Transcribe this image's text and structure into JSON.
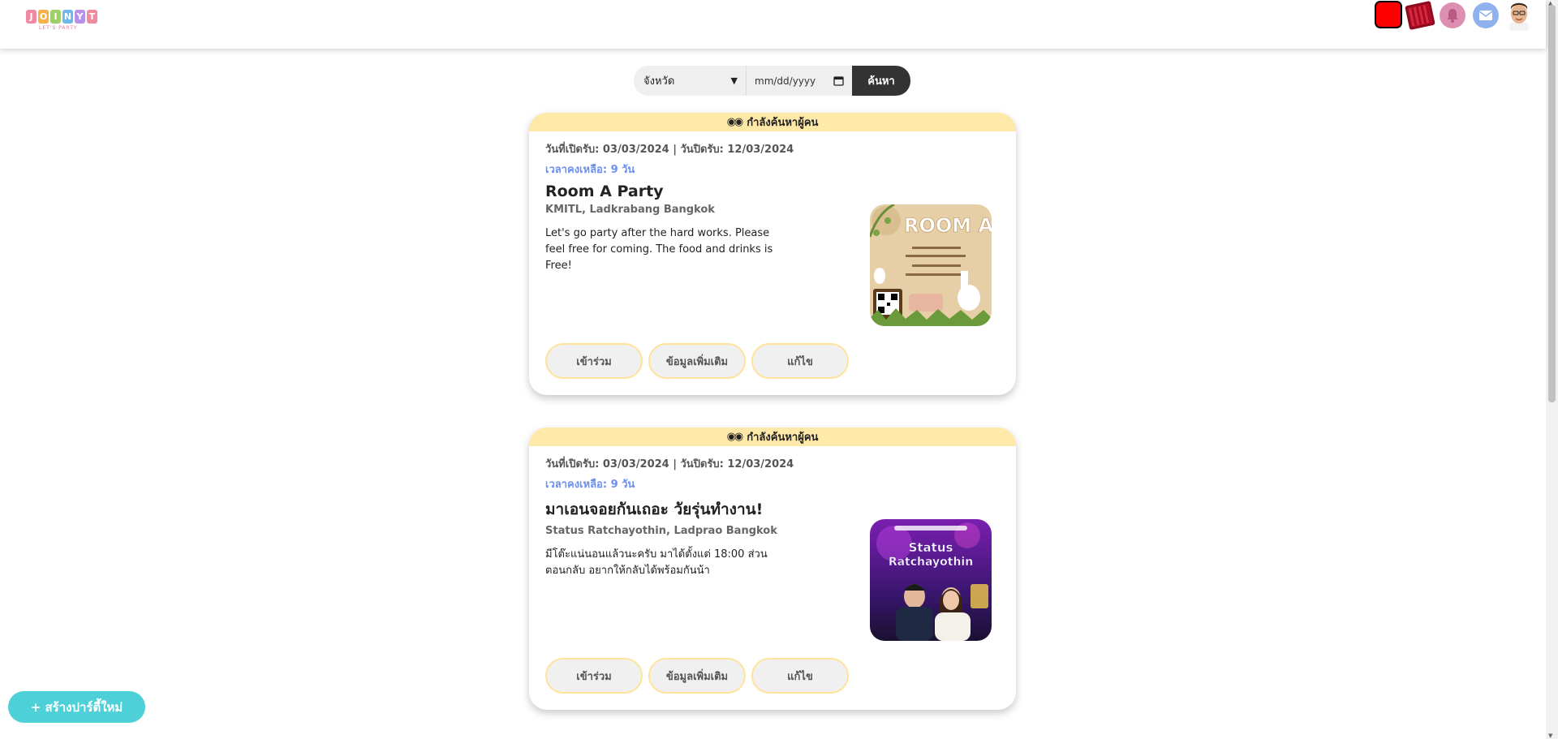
{
  "header": {
    "logo_text": "JOINYT",
    "logo_sub": "LET'S PARTY",
    "icons": [
      "red-square-icon",
      "ticket-icon",
      "bell-icon",
      "mail-icon",
      "avatar"
    ]
  },
  "search": {
    "province_label": "จังหวัด",
    "date_placeholder": "mm/dd/yyyy",
    "button_label": "ค้นหา"
  },
  "cards": [
    {
      "status": "กำลังค้นหาผู้คน",
      "dates": "วันที่เปิดรับ: 03/03/2024 | วันปิดรับ: 12/03/2024",
      "remain": "เวลาคงเหลือ: 9 วัน",
      "title": "Room A Party",
      "location": "KMITL, Ladkrabang Bangkok",
      "description": "Let's go party after the hard works. Please feel free for coming. The food and drinks is Free!",
      "image_label": "ROOM A",
      "buttons": {
        "join": "เข้าร่วม",
        "more": "ข้อมูลเพิ่มเติม",
        "edit": "แก้ไข"
      }
    },
    {
      "status": "กำลังค้นหาผู้คน",
      "dates": "วันที่เปิดรับ: 03/03/2024 | วันปิดรับ: 12/03/2024",
      "remain": "เวลาคงเหลือ: 9 วัน",
      "title": "มาเอนจอยกันเถอะ วัยรุ่นทำงาน!",
      "location": "Status Ratchayothin, Ladprao Bangkok",
      "description": "มีโต๊ะแน่นอนแล้วนะครับ มาได้ตั้งแต่ 18:00 ส่วนตอนกลับ อยากให้กลับได้พร้อมกันน้า",
      "image_label": "Status Ratchayothin",
      "buttons": {
        "join": "เข้าร่วม",
        "more": "ข้อมูลเพิ่มเติม",
        "edit": "แก้ไข"
      }
    }
  ],
  "fab": {
    "label": "+ สร้างปาร์ตี้ใหม่"
  },
  "colors": {
    "status_bg": "#ffe9a8",
    "remain_text": "#6c8ff0",
    "fab_bg": "#4dd0d8",
    "search_btn_bg": "#333333"
  }
}
